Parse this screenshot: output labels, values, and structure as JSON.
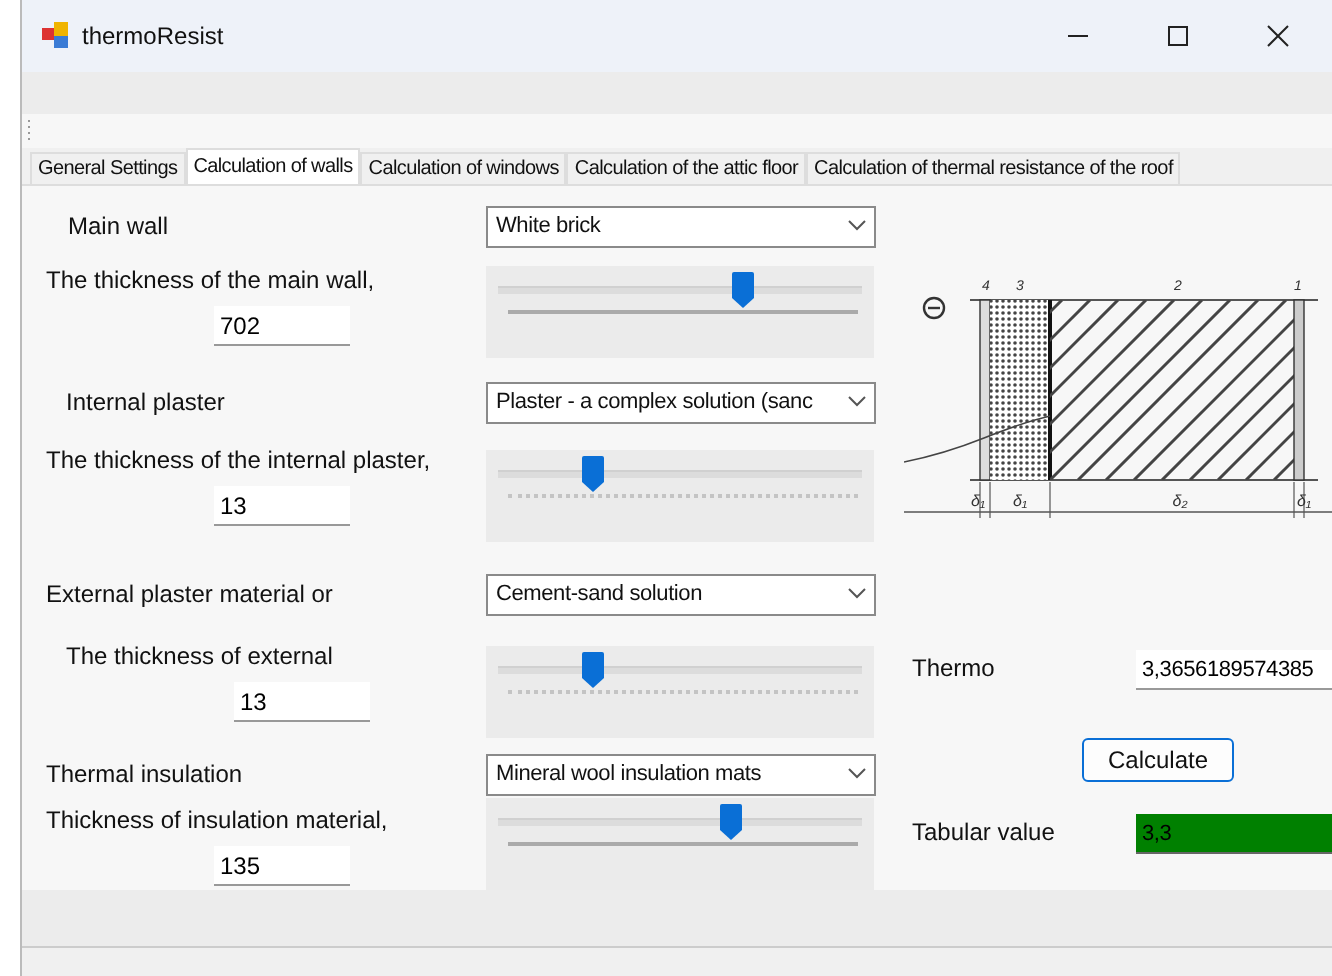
{
  "window": {
    "title": "thermoResist"
  },
  "tabs": [
    {
      "label": "General Settings",
      "selected": false
    },
    {
      "label": "Calculation of walls",
      "selected": true
    },
    {
      "label": "Calculation of windows",
      "selected": false
    },
    {
      "label": "Calculation of the attic floor",
      "selected": false
    },
    {
      "label": "Calculation of thermal resistance of the roof",
      "selected": false
    }
  ],
  "layers": [
    {
      "label": "Main wall",
      "material": "White brick",
      "thickness_label": "The thickness of the main wall,",
      "thickness": "702",
      "slider": {
        "level": 0.69,
        "kind": "solid"
      }
    },
    {
      "label": "Internal plaster",
      "material": "Plaster - a complex solution (sanc",
      "thickness_label": "The thickness of the  internal plaster,",
      "thickness": "13",
      "slider": {
        "level": 0.27,
        "kind": "dotted"
      }
    },
    {
      "label": "External plaster material or",
      "material": "Cement-sand solution",
      "thickness_label": "The thickness of external",
      "thickness": "13",
      "slider": {
        "level": 0.27,
        "kind": "dotted"
      }
    },
    {
      "label": "Thermal insulation",
      "material": "Mineral wool insulation mats",
      "thickness_label": "Thickness of insulation material,",
      "thickness": "135",
      "slider": {
        "level": 0.66,
        "kind": "solid"
      }
    }
  ],
  "diagram": {
    "layer_numbers": [
      "4",
      "3",
      "2",
      "1"
    ],
    "thickness_labels": [
      "δ₁",
      "δ₁",
      "δ₂",
      "δ₁"
    ]
  },
  "results": {
    "thermo_label": "Thermo",
    "thermo_value": "3,3656189574385",
    "calculate_button": "Calculate",
    "tabular_label": "Tabular value",
    "tabular_value": "3,3"
  }
}
